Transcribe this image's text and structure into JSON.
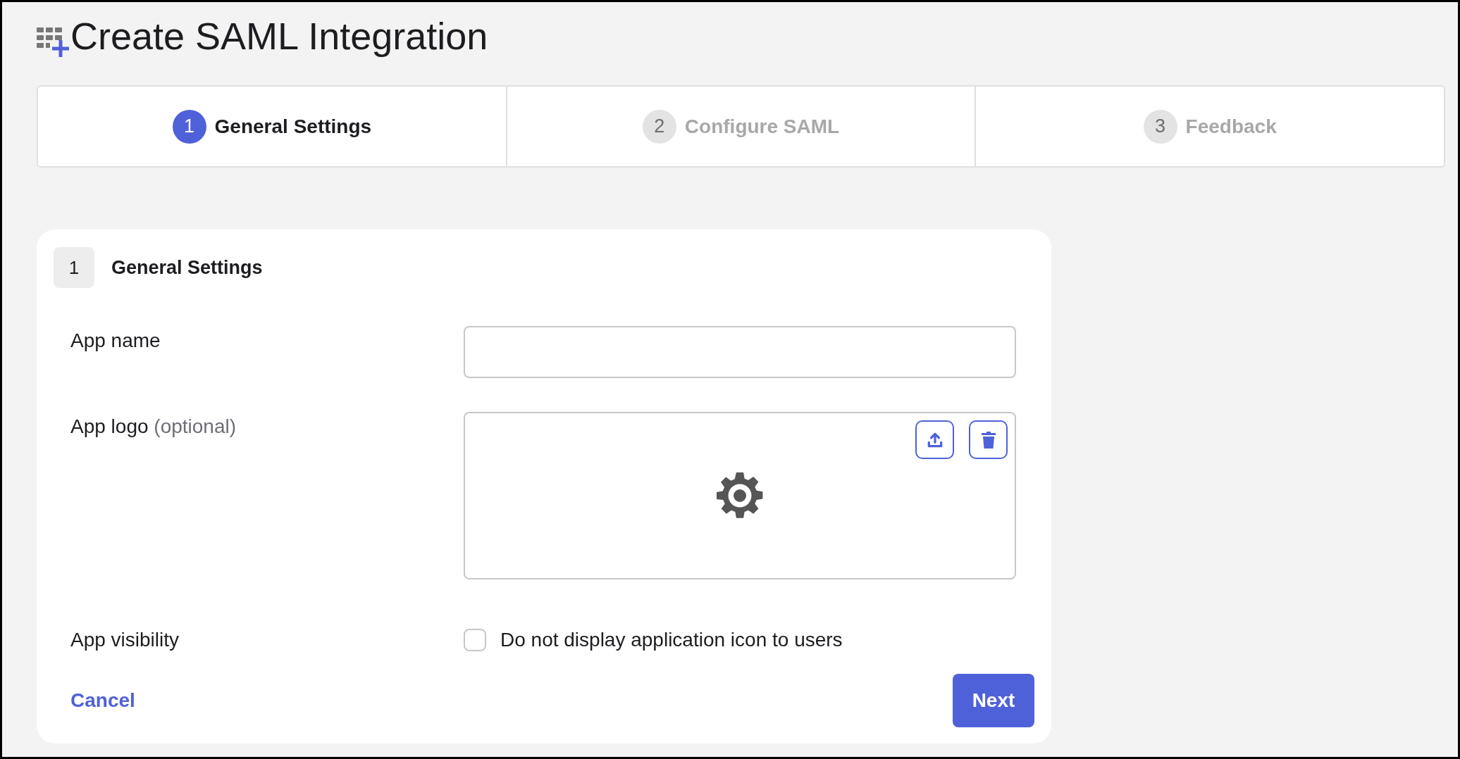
{
  "page": {
    "title": "Create SAML Integration"
  },
  "steps": [
    {
      "number": "1",
      "label": "General Settings",
      "selected": true
    },
    {
      "number": "2",
      "label": "Configure SAML",
      "selected": false
    },
    {
      "number": "3",
      "label": "Feedback",
      "selected": false
    }
  ],
  "section": {
    "number": "1",
    "title": "General Settings"
  },
  "fields": [
    {
      "kind": "text",
      "label": "App name"
    },
    {
      "kind": "logo",
      "label": "App logo",
      "hint": "(optional)"
    },
    {
      "kind": "checkbox",
      "label": "App visibility",
      "option": "Do not display application icon to users",
      "checked": false
    }
  ],
  "actions": {
    "cancel": "Cancel",
    "next": "Next"
  }
}
